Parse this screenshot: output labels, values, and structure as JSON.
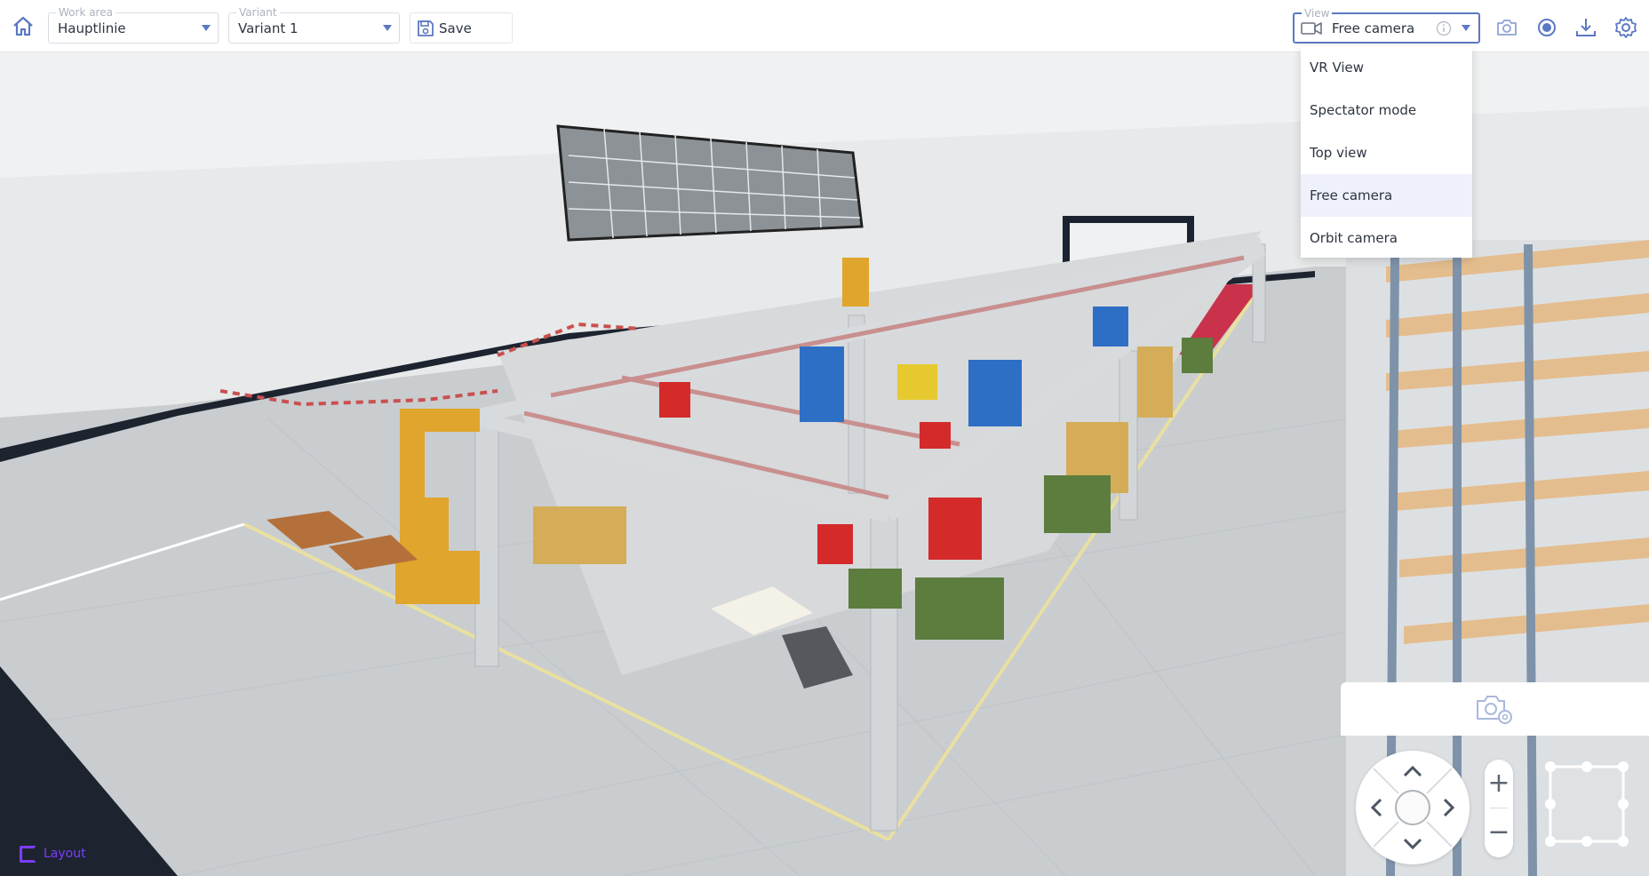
{
  "topbar": {
    "work_area": {
      "label": "Work area",
      "value": "Hauptlinie"
    },
    "variant": {
      "label": "Variant",
      "value": "Variant 1"
    },
    "save_label": "Save",
    "view": {
      "label": "View",
      "value": "Free camera"
    },
    "icons": [
      "home-icon",
      "camera-icon",
      "record-icon",
      "download-icon",
      "settings-icon"
    ]
  },
  "view_menu": {
    "items": [
      {
        "label": "VR View",
        "selected": false
      },
      {
        "label": "Spectator mode",
        "selected": false
      },
      {
        "label": "Top view",
        "selected": false
      },
      {
        "label": "Free camera",
        "selected": true
      },
      {
        "label": "Orbit camera",
        "selected": false
      }
    ]
  },
  "controls": {
    "zoom_in": "+",
    "zoom_out": "−",
    "layout_label": "Layout"
  },
  "colors": {
    "accent": "#5b78c2",
    "selected_bg": "#eef1fb",
    "layout_brand": "#7d3cff"
  }
}
